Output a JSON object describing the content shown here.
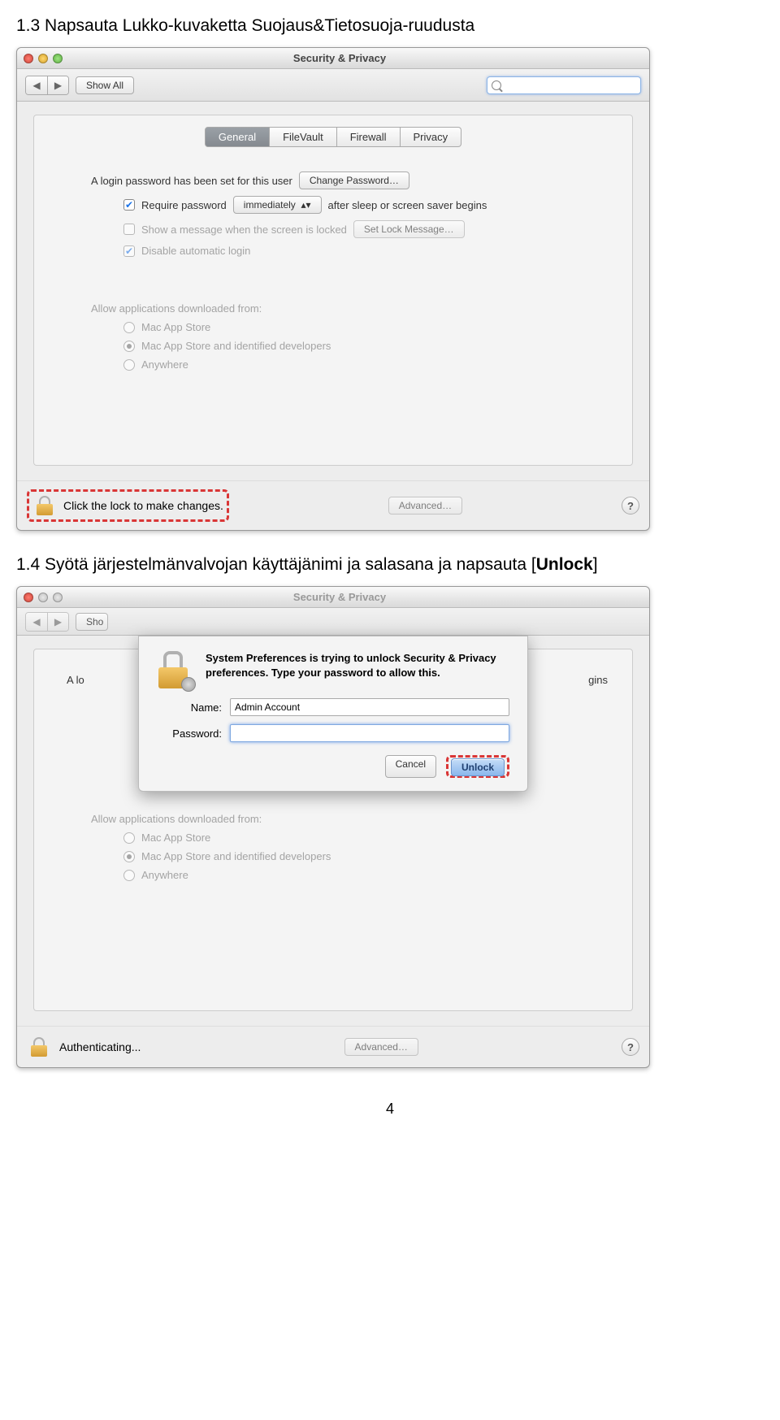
{
  "section1_prefix": "1.3  ",
  "section1_text": "Napsauta Lukko-kuvaketta Suojaus&Tietosuoja-ruudusta",
  "section2_prefix": "1.4  ",
  "section2_text_a": "Syötä järjestelmänvalvojan käyttäjänimi ja salasana ja napsauta [",
  "section2_bold": "Unlock",
  "section2_text_b": "]",
  "page_number": "4",
  "window": {
    "title": "Security & Privacy",
    "show_all": "Show All",
    "tabs": [
      "General",
      "FileVault",
      "Firewall",
      "Privacy"
    ],
    "active_tab": 0,
    "password_set_text": "A login password has been set for this user",
    "change_password_btn": "Change Password…",
    "require_prefix": "Require password",
    "require_dropdown": "immediately",
    "require_suffix": "after sleep or screen saver begins",
    "show_message": "Show a message when the screen is locked",
    "set_lock_msg_btn": "Set Lock Message…",
    "disable_auto_login": "Disable automatic login",
    "allow_apps_heading": "Allow applications downloaded from:",
    "radio_opts": [
      "Mac App Store",
      "Mac App Store and identified developers",
      "Anywhere"
    ],
    "lock_hint": "Click the lock to make changes.",
    "advanced_btn": "Advanced…",
    "help": "?"
  },
  "window2": {
    "a_lo": "A lo",
    "sho": "Sho",
    "gins": "gins",
    "authenticating": "Authenticating...",
    "dialog_msg": "System Preferences is trying to unlock Security & Privacy preferences. Type your password to allow this.",
    "name_label": "Name:",
    "name_value": "Admin Account",
    "password_label": "Password:",
    "cancel_btn": "Cancel",
    "unlock_btn": "Unlock"
  }
}
